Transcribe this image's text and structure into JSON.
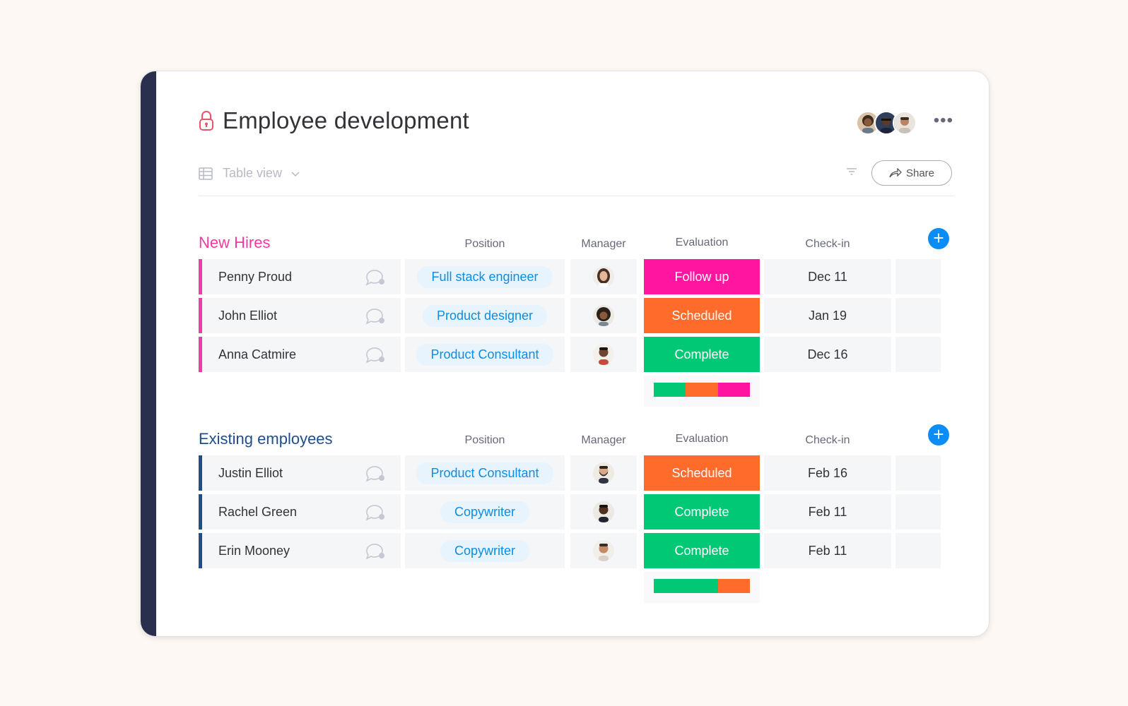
{
  "board": {
    "title": "Employee development",
    "view_label": "Table view",
    "share_label": "Share"
  },
  "columns": {
    "position": "Position",
    "manager": "Manager",
    "evaluation": "Evaluation",
    "checkin": "Check-in"
  },
  "colors": {
    "new_hires": "#f23aa0",
    "existing": "#1f4e8c",
    "follow_up": "#ff15a0",
    "scheduled": "#ff6b2b",
    "complete": "#00c875",
    "accent": "#0c8df5"
  },
  "groups": [
    {
      "title": "New Hires",
      "rows": [
        {
          "name": "Penny Proud",
          "position": "Full stack engineer",
          "manager_avatar": "woman-avatar",
          "evaluation": "Follow up",
          "checkin": "Dec 11"
        },
        {
          "name": "John Elliot",
          "position": "Product designer",
          "manager_avatar": "curly-hair-avatar",
          "evaluation": "Scheduled",
          "checkin": "Jan 19"
        },
        {
          "name": "Anna Catmire",
          "position": "Product Consultant",
          "manager_avatar": "man-avatar",
          "evaluation": "Complete",
          "checkin": "Dec 16"
        }
      ],
      "summary": [
        {
          "status": "Complete",
          "fraction": 0.3333
        },
        {
          "status": "Scheduled",
          "fraction": 0.3333
        },
        {
          "status": "Follow up",
          "fraction": 0.3334
        }
      ]
    },
    {
      "title": "Existing employees",
      "rows": [
        {
          "name": "Justin Elliot",
          "position": "Product Consultant",
          "manager_avatar": "bearded-man-avatar",
          "evaluation": "Scheduled",
          "checkin": "Feb 16"
        },
        {
          "name": "Rachel Green",
          "position": "Copywriter",
          "manager_avatar": "man-avatar",
          "evaluation": "Complete",
          "checkin": "Feb 11"
        },
        {
          "name": "Erin Mooney",
          "position": "Copywriter",
          "manager_avatar": "smiling-man-avatar",
          "evaluation": "Complete",
          "checkin": "Feb 11"
        }
      ],
      "summary": [
        {
          "status": "Complete",
          "fraction": 0.6667
        },
        {
          "status": "Scheduled",
          "fraction": 0.3333
        }
      ]
    }
  ]
}
